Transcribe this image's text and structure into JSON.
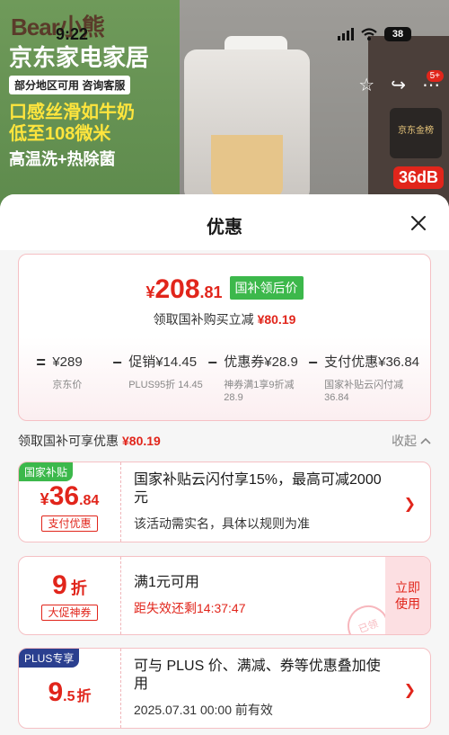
{
  "status_bar": {
    "time": "9:22",
    "battery": "38"
  },
  "background": {
    "brand": "Bear小熊",
    "headline": "京东家电家居",
    "badge": "部分地区可用 咨询客服",
    "feature_1": "口感丝滑如牛奶",
    "feature_2": "低至108微米",
    "feature_3": "高温洗+热除菌",
    "gold_badge": "京东金榜",
    "noise_badge": "36dB",
    "message_count": "5+"
  },
  "sheet": {
    "title": "优惠"
  },
  "price_card": {
    "currency": "¥",
    "price_int": "208",
    "price_dec": ".81",
    "price_tag": "国补领后价",
    "saving_label": "领取国补购买立减",
    "saving_amount": "¥80.19",
    "formula": [
      {
        "op": "=",
        "value": "¥289",
        "sub": "京东价"
      },
      {
        "op": "−",
        "value": "促销¥14.45",
        "sub": "PLUS95折 14.45"
      },
      {
        "op": "−",
        "value": "优惠券¥28.9",
        "sub": "神券满1享9折减 28.9"
      },
      {
        "op": "−",
        "value": "支付优惠¥36.84",
        "sub": "国家补贴云闪付减 36.84"
      }
    ]
  },
  "section": {
    "label": "领取国补可享优惠",
    "amount": "¥80.19",
    "collapse": "收起"
  },
  "offers": [
    {
      "corner": "国家补贴",
      "currency": "¥",
      "int": "36",
      "dec": ".84",
      "tag": "支付优惠",
      "title": "国家补贴云闪付享15%，最高可减2000元",
      "sub": "该活动需实名，具体以规则为准"
    },
    {
      "int": "9",
      "unit": "折",
      "tag": "大促神券",
      "title": "满1元可用",
      "sub": "距失效还剩14:37:47",
      "claim": "立即使用",
      "stamp": "已领"
    },
    {
      "corner": "PLUS专享",
      "int": "9",
      "dec": ".5",
      "unit": "折",
      "title": "可与 PLUS 价、满减、券等优惠叠加使用",
      "sub": "2025.07.31 00:00 前有效"
    }
  ],
  "colors": {
    "accent": "#e1251b",
    "green_tag": "#3cb84b",
    "plus_tag": "#2a3f8f"
  }
}
